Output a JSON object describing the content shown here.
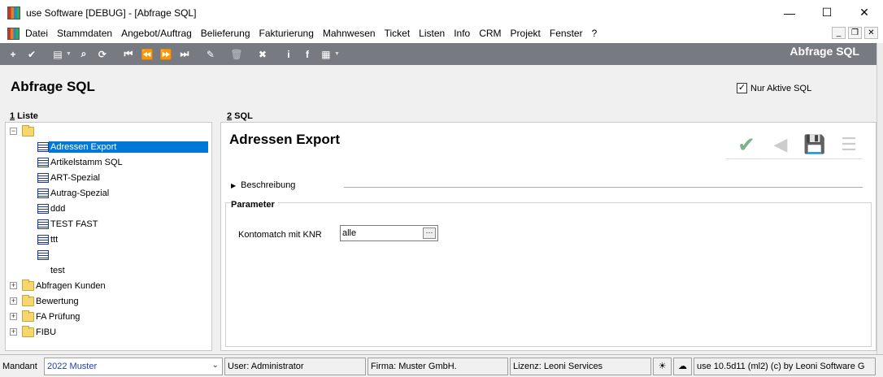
{
  "window": {
    "title": "use Software [DEBUG] - [Abfrage SQL]",
    "minimize": "—",
    "maximize": "☐",
    "close": "✕"
  },
  "menu": {
    "items": [
      "Datei",
      "Stammdaten",
      "Angebot/Auftrag",
      "Belieferung",
      "Fakturierung",
      "Mahnwesen",
      "Ticket",
      "Listen",
      "Info",
      "CRM",
      "Projekt",
      "Fenster",
      "?"
    ],
    "mdi_minimize": "_",
    "mdi_restore": "❐",
    "mdi_close": "✕"
  },
  "toolbar": {
    "title": "Abfrage SQL",
    "icons": [
      "add-icon",
      "check-icon",
      "print-icon",
      "search-icon",
      "refresh-icon",
      "first-icon",
      "previous-icon",
      "next-icon",
      "last-icon",
      "edit-icon",
      "delete-icon",
      "cancel-icon",
      "info-icon",
      "facebook-icon",
      "grid-icon"
    ]
  },
  "header": {
    "page_title": "Abfrage SQL",
    "nur_aktive_label": "Nur Aktive SQL",
    "nur_aktive_checked": true
  },
  "liste": {
    "label_num": "1",
    "label_text": " Liste",
    "tree": [
      {
        "label": "",
        "type": "folder",
        "expanded": true
      },
      {
        "label": "Adressen Export",
        "type": "sql",
        "selected": true
      },
      {
        "label": "Artikelstamm SQL",
        "type": "sql"
      },
      {
        "label": "ART-Spezial",
        "type": "sql"
      },
      {
        "label": "Autrag-Spezial",
        "type": "sql"
      },
      {
        "label": "ddd",
        "type": "sql"
      },
      {
        "label": "TEST FAST",
        "type": "sql"
      },
      {
        "label": "ttt",
        "type": "sql"
      },
      {
        "label": "",
        "type": "sql"
      },
      {
        "label": "test",
        "type": "none"
      },
      {
        "label": "Abfragen Kunden",
        "type": "folder",
        "expanded": false
      },
      {
        "label": "Bewertung",
        "type": "folder",
        "expanded": false
      },
      {
        "label": "FA Prüfung",
        "type": "folder",
        "expanded": false
      },
      {
        "label": "FIBU",
        "type": "folder",
        "expanded": false
      }
    ]
  },
  "sql": {
    "label_num": "2",
    "label_text": " SQL",
    "title": "Adressen Export",
    "beschreibung": "Beschreibung",
    "parameter_title": "Parameter",
    "param_label": "Kontomatch mit KNR",
    "param_value": "alle",
    "dots": "···"
  },
  "status": {
    "mandant_label": "Mandant",
    "mandant_value": "2022 Muster",
    "user": "User: Administrator",
    "firma": "Firma: Muster GmbH.",
    "lizenz": "Lizenz: Leoni Services",
    "version": "use 10.5d11 (ml2)  (c) by Leoni Software G"
  },
  "colors": {
    "toolbar_bg": "#777a80",
    "selection": "#0078d7",
    "panel_bg": "#f0f0f0"
  }
}
